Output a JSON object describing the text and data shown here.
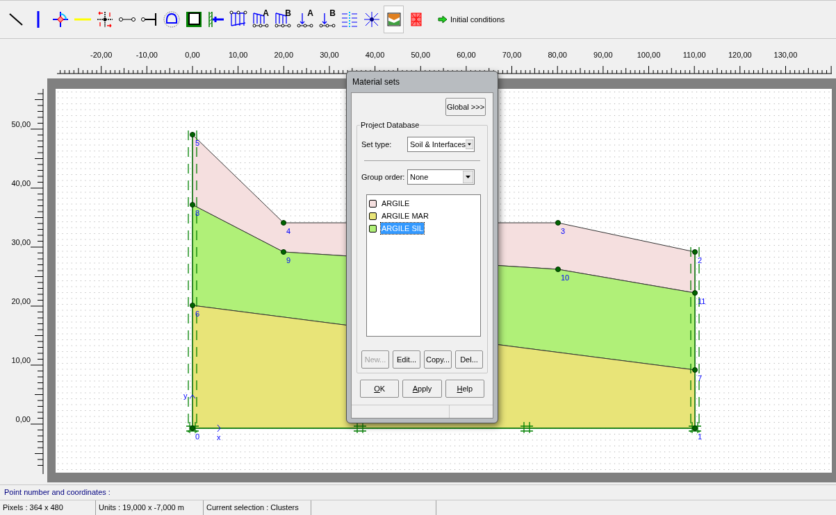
{
  "toolbar": {
    "tools": [
      {
        "kind": "diagonal-line",
        "selected": false
      },
      {
        "kind": "vertical-line",
        "selected": false
      },
      {
        "kind": "hinge",
        "selected": false
      },
      {
        "kind": "geogrid",
        "selected": false
      },
      {
        "kind": "interface",
        "selected": false
      },
      {
        "kind": "node-anchor",
        "selected": false
      },
      {
        "kind": "fixed-anchor",
        "selected": false
      },
      {
        "kind": "tunnel",
        "selected": false
      },
      {
        "kind": "clamp",
        "selected": false
      },
      {
        "kind": "wall",
        "selected": false
      },
      {
        "kind": "distributed-load",
        "selected": false
      },
      {
        "kind": "distributed-load-letter",
        "letter": "A",
        "selected": false
      },
      {
        "kind": "distributed-load-letter",
        "letter": "B",
        "selected": false
      },
      {
        "kind": "point-load",
        "letter": "A",
        "selected": false
      },
      {
        "kind": "point-load",
        "letter": "B",
        "selected": false
      },
      {
        "kind": "drain",
        "selected": false
      },
      {
        "kind": "well",
        "selected": false
      },
      {
        "kind": "materials",
        "selected": true
      },
      {
        "kind": "mesh",
        "selected": false
      }
    ],
    "initial_conditions": {
      "label": "Initial conditions"
    }
  },
  "ruler_x": {
    "labels": [
      "-20,00",
      "-10,00",
      "0,00",
      "10,00",
      "20,00",
      "30,00",
      "40,00",
      "50,00",
      "60,00",
      "70,00",
      "80,00",
      "90,00",
      "100,00",
      "110,00",
      "120,00",
      "130,00"
    ]
  },
  "ruler_y": {
    "labels": [
      "50,00",
      "40,00",
      "30,00",
      "20,00",
      "10,00",
      "0,00"
    ]
  },
  "geometry": {
    "points": [
      {
        "label": "5"
      },
      {
        "label": "8"
      },
      {
        "label": "4"
      },
      {
        "label": "3"
      },
      {
        "label": "9"
      },
      {
        "label": "2"
      },
      {
        "label": "10"
      },
      {
        "label": "11"
      },
      {
        "label": "6"
      },
      {
        "label": "7"
      },
      {
        "label": "0"
      },
      {
        "label": "1"
      }
    ],
    "axes": {
      "x": "x",
      "y": "y"
    },
    "clusters": [
      {
        "color": "#f5dfdf"
      },
      {
        "color": "#b0f078"
      },
      {
        "color": "#e8e478"
      }
    ]
  },
  "dialog": {
    "title": "Material sets",
    "global_button": "Global >>>",
    "group_title": "Project Database",
    "set_type": {
      "label": "Set type:",
      "value": "Soil & Interfaces"
    },
    "group_order": {
      "label": "Group order:",
      "value": "None"
    },
    "materials": [
      {
        "name": "ARGILE",
        "color": "#f5dfdf",
        "selected": false
      },
      {
        "name": "ARGILE MAR",
        "color": "#e8e478",
        "selected": false
      },
      {
        "name": "ARGILE SIL",
        "color": "#b0f078",
        "selected": true
      }
    ],
    "list_buttons": [
      {
        "label": "New...",
        "disabled": true
      },
      {
        "label": "Edit...",
        "disabled": false
      },
      {
        "label": "Copy...",
        "disabled": false
      },
      {
        "label": "Del...",
        "disabled": false
      }
    ],
    "buttons": [
      {
        "label": "OK",
        "underline_first": true
      },
      {
        "label": "Apply",
        "underline_first": true
      },
      {
        "label": "Help",
        "underline_first": true
      }
    ]
  },
  "info_line": "Point number and coordinates :",
  "status_bar": [
    "Pixels : 364 x 480",
    "Units : 19,000 x -7,000 m",
    "Current selection : Clusters"
  ]
}
